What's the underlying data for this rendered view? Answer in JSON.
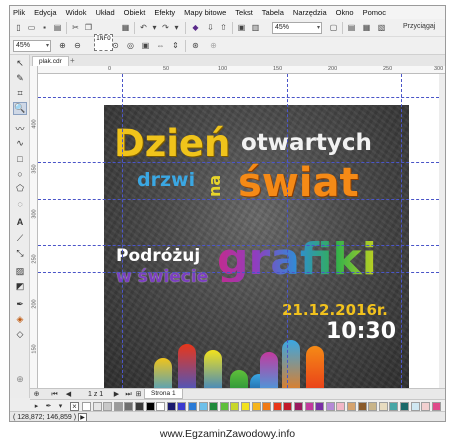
{
  "menu": [
    "Plik",
    "Edycja",
    "Widok",
    "Układ",
    "Obiekt",
    "Efekty",
    "Mapy bitowe",
    "Tekst",
    "Tabela",
    "Narzędzia",
    "Okno",
    "Pomoc"
  ],
  "toolbar": {
    "zoom_value": "45%",
    "zoom_value_2": "45%",
    "snap_label": "Przyciągaj",
    "info_label": "INFO"
  },
  "document_tab": {
    "name": "plak.cdr",
    "add": "+"
  },
  "ruler": {
    "h_numbers": [
      "0",
      "50",
      "100",
      "150",
      "200",
      "250",
      "300"
    ],
    "v_numbers": [
      "400",
      "350",
      "300",
      "250",
      "200",
      "150",
      "100"
    ]
  },
  "poster": {
    "line1": "Dzień",
    "line2": "otwartych",
    "line3": "drzwi",
    "line4": "na",
    "line5": "świat",
    "line6": "Podróżuj",
    "line7": "w świecie",
    "line8": "grafiki",
    "date": "21.12.2016r.",
    "time": "10:30"
  },
  "pagebar": {
    "count": "1 z 1",
    "page_tab": "Strona 1"
  },
  "status": {
    "coords": "( 128,872; 146,859 )"
  },
  "palette_colors": [
    "#ffffff",
    "#e6e6e6",
    "#c8c8c8",
    "#9b9b9b",
    "#6e6e6e",
    "#3a3a3a",
    "#000000",
    "#ffffff",
    "#1a1a6e",
    "#3a3ad0",
    "#2a7ad6",
    "#6ec0ea",
    "#1f8a3a",
    "#5fbf3a",
    "#c8d82a",
    "#f2e21d",
    "#f5b51d",
    "#f07a16",
    "#e8361a",
    "#c21a2a",
    "#9a1a5e",
    "#c23a9e",
    "#7a2fa6",
    "#b58ad6",
    "#f2b6c6",
    "#d6a36e",
    "#8a5a2a",
    "#c8b48a",
    "#e8dcc0",
    "#46a6a6",
    "#1a6a6a",
    "#d0e8f2",
    "#f2d0d0",
    "#e04a8a",
    "#ffffff"
  ],
  "watermark": "www.EgzaminZawodowy.info"
}
